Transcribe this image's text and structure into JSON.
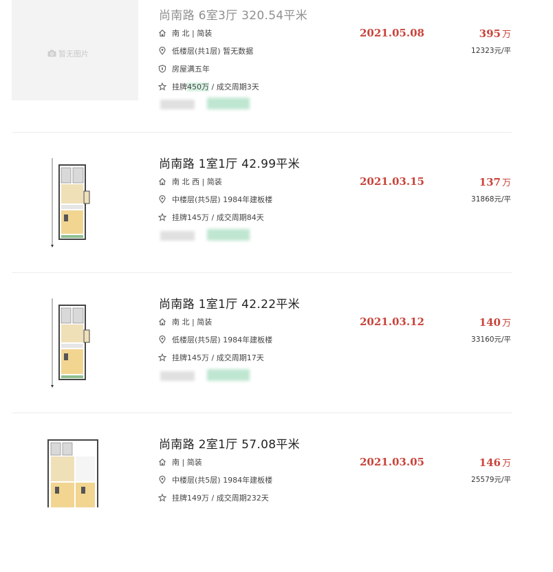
{
  "listings": [
    {
      "title": "尚南路 6室3厅 320.54平米",
      "has_image": false,
      "no_image_text": "暂无图片",
      "orientation": "南 北 | 简装",
      "floor": "低楼层(共1层) 暂无数据",
      "tag": "房屋满五年",
      "listing_price": "挂牌",
      "listing_price_highlight": "450万",
      "deal_cycle": " / 成交周期3天",
      "deal_date": "2021.05.08",
      "total_price": "395",
      "price_unit": "万",
      "unit_price": "12323元/平"
    },
    {
      "title": "尚南路 1室1厅 42.99平米",
      "has_image": true,
      "orientation": "南 北 西 | 简装",
      "floor": "中楼层(共5层) 1984年建板楼",
      "listing_price": "挂牌145万",
      "deal_cycle": " / 成交周期84天",
      "deal_date": "2021.03.15",
      "total_price": "137",
      "price_unit": "万",
      "unit_price": "31868元/平"
    },
    {
      "title": "尚南路 1室1厅 42.22平米",
      "has_image": true,
      "orientation": "南 北 | 简装",
      "floor": "低楼层(共5层) 1984年建板楼",
      "listing_price": "挂牌145万",
      "deal_cycle": " / 成交周期17天",
      "deal_date": "2021.03.12",
      "total_price": "140",
      "price_unit": "万",
      "unit_price": "33160元/平"
    },
    {
      "title": "尚南路 2室1厅 57.08平米",
      "has_image": true,
      "orientation": "南 | 简装",
      "floor": "中楼层(共5层) 1984年建板楼",
      "listing_price": "挂牌149万",
      "deal_cycle": " / 成交周期232天",
      "deal_date": "2021.03.05",
      "total_price": "146",
      "price_unit": "万",
      "unit_price": "25579元/平"
    }
  ],
  "colors": {
    "accent": "#c8443a",
    "highlight": "#d8f3e4",
    "divider": "#ececec"
  },
  "icons": [
    "home-icon",
    "location-pin-icon",
    "shield-icon",
    "star-icon",
    "camera-icon"
  ]
}
